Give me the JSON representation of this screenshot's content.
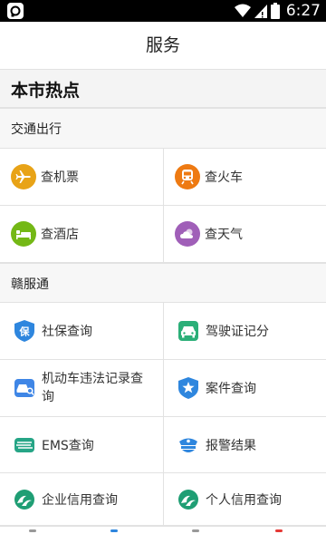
{
  "status_bar": {
    "time": "6:27",
    "icons": [
      "signal-app-icon",
      "wifi-icon",
      "cell-signal-icon",
      "battery-icon"
    ]
  },
  "header": {
    "title": "服务"
  },
  "hot": {
    "label": "本市热点"
  },
  "sections": {
    "transport": {
      "label": "交通出行",
      "items": [
        {
          "label": "查机票",
          "icon": "airplane-icon",
          "color": "#E8A317"
        },
        {
          "label": "查火车",
          "icon": "train-icon",
          "color": "#EE7A12"
        },
        {
          "label": "查酒店",
          "icon": "hotel-bed-icon",
          "color": "#74B816"
        },
        {
          "label": "查天气",
          "icon": "weather-cloud-icon",
          "color": "#A05FB8"
        }
      ]
    },
    "ganfutong": {
      "label": "赣服通",
      "items": [
        {
          "label": "社保查询",
          "icon": "social-security-shield-icon",
          "color": "#2E86DE"
        },
        {
          "label": "驾驶证记分",
          "icon": "drivers-license-icon",
          "color": "#2BAF78"
        },
        {
          "label": "机动车违法记录查询",
          "icon": "vehicle-violation-icon",
          "color": "#3F86E6"
        },
        {
          "label": "案件查询",
          "icon": "police-badge-icon",
          "color": "#2E86DE"
        },
        {
          "label": "EMS查询",
          "icon": "ems-icon",
          "color": "#26A586"
        },
        {
          "label": "报警结果",
          "icon": "police-cap-icon",
          "color": "#2E86DE"
        },
        {
          "label": "企业信用查询",
          "icon": "credit-wave-icon",
          "color": "#1F9E74"
        },
        {
          "label": "个人信用查询",
          "icon": "credit-wave-icon",
          "color": "#1F9E74"
        }
      ]
    }
  },
  "colors": {
    "divider": "#e2e2e2",
    "section_bg": "#f7f7f7",
    "hot_bg": "#f4f4f4"
  }
}
